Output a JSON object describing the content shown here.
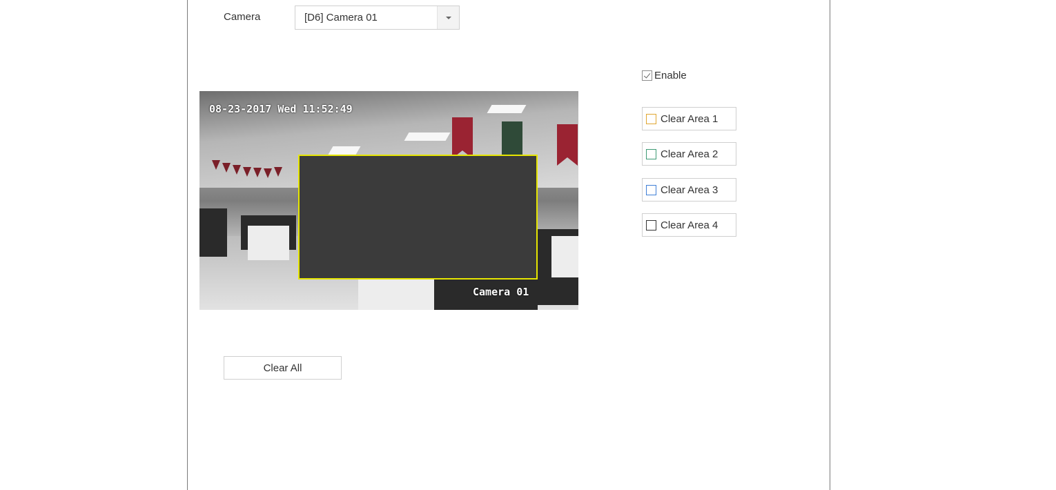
{
  "camera": {
    "label": "Camera",
    "selected": "[D6] Camera 01"
  },
  "preview": {
    "osd_time": "08-23-2017 Wed 11:52:49",
    "osd_name": "Camera 01"
  },
  "enable": {
    "label": "Enable",
    "checked": true
  },
  "areas": [
    {
      "label": "Clear Area 1",
      "color": "#e0a630"
    },
    {
      "label": "Clear Area 2",
      "color": "#3d9a74"
    },
    {
      "label": "Clear Area 3",
      "color": "#3f7fd6"
    },
    {
      "label": "Clear Area 4",
      "color": "#333333"
    }
  ],
  "mask_color": "#e6e600",
  "clear_all_label": "Clear All"
}
